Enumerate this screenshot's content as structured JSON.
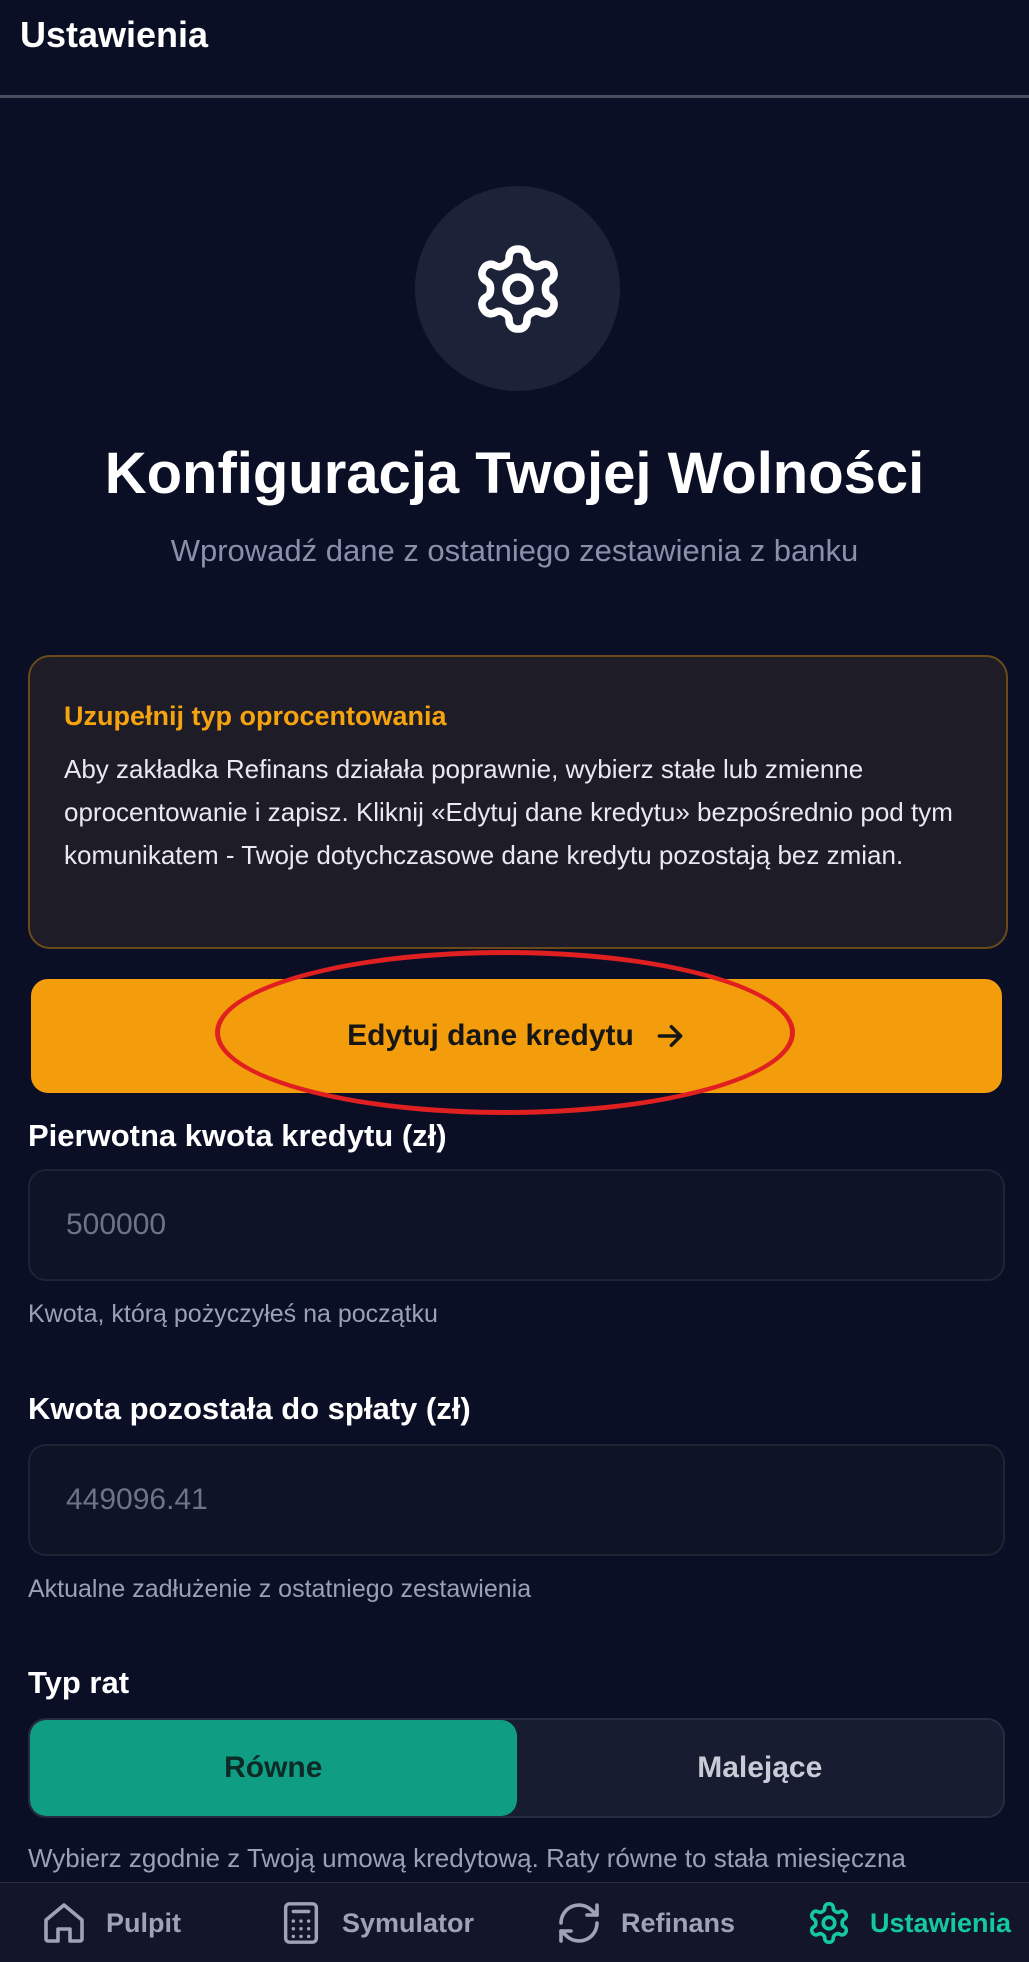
{
  "header": {
    "title": "Ustawienia"
  },
  "hero": {
    "icon": "gear-icon",
    "title": "Konfiguracja Twojej Wolności",
    "subtitle": "Wprowadź dane z ostatniego zestawienia z banku"
  },
  "notice": {
    "title": "Uzupełnij typ oprocentowania",
    "body": "Aby zakładka Refinans działała poprawnie, wybierz stałe lub zmienne oprocentowanie i zapisz. Kliknij «Edytuj dane kredytu» bezpośrednio pod tym komunikatem - Twoje dotychczasowe dane kredytu pozostają bez zmian.",
    "accent_color": "#f5a30f"
  },
  "edit_button": {
    "label": "Edytuj dane kredytu",
    "icon": "arrow-right-icon",
    "color": "#f39c0c"
  },
  "form": {
    "original_amount": {
      "label": "Pierwotna kwota kredytu (zł)",
      "value": "500000",
      "help": "Kwota, którą pożyczyłeś na początku"
    },
    "remaining_amount": {
      "label": "Kwota pozostała do spłaty (zł)",
      "value": "449096.41",
      "help": "Aktualne zadłużenie z ostatniego zestawienia"
    },
    "installment_type": {
      "label": "Typ rat",
      "options": [
        "Równe",
        "Malejące"
      ],
      "selected": "Równe",
      "active_color": "#0f9e84",
      "description": "Wybierz zgodnie z Twoją umową kredytową. Raty równe to stała miesięczna"
    }
  },
  "nav": {
    "items": [
      {
        "label": "Pulpit",
        "icon": "home-icon"
      },
      {
        "label": "Symulator",
        "icon": "calculator-icon"
      },
      {
        "label": "Refinans",
        "icon": "refresh-icon"
      },
      {
        "label": "Ustawienia",
        "icon": "gear-icon"
      }
    ],
    "active": "Ustawienia",
    "active_color": "#14c9a1"
  }
}
